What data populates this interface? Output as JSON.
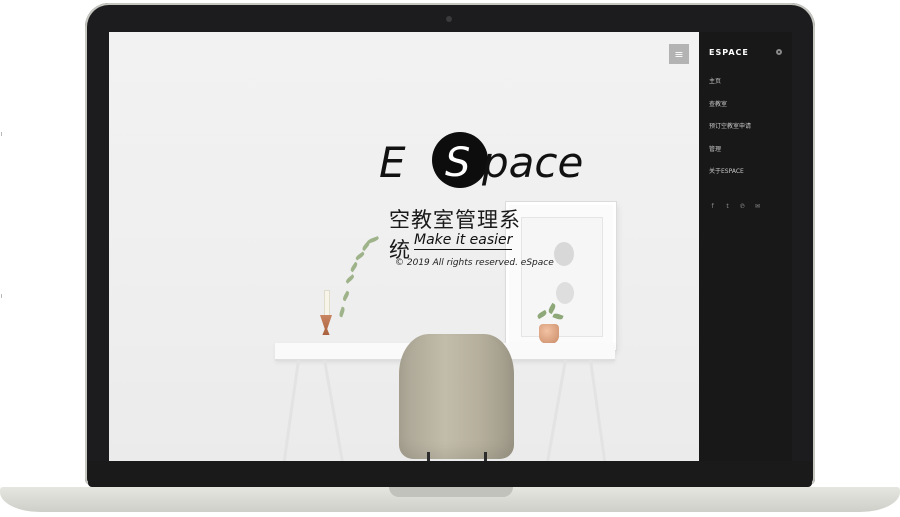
{
  "hero": {
    "logo_e": "E",
    "logo_s": "S",
    "logo_rest": "pace",
    "subtitle": "空教室管理系统",
    "tagline": "Make it easier",
    "copyright": "© 2019  All rights reserved. eSpace"
  },
  "menu_toggle": {
    "icon": "hamburger-icon",
    "glyph": "≡"
  },
  "sidebar": {
    "brand": "ESPACE",
    "items": [
      {
        "label": "主页"
      },
      {
        "label": "查教室"
      },
      {
        "label": "预订空教室申请"
      },
      {
        "label": "管理"
      },
      {
        "label": "关于ESPACE"
      }
    ],
    "social": [
      {
        "icon": "facebook-icon",
        "glyph": "f"
      },
      {
        "icon": "twitter-icon",
        "glyph": "t"
      },
      {
        "icon": "pinterest-icon",
        "glyph": "℗"
      },
      {
        "icon": "mail-icon",
        "glyph": "✉"
      }
    ]
  },
  "colors": {
    "sidebar_bg": "#181818",
    "hero_bg": "#efefef",
    "accent": "#111111"
  }
}
